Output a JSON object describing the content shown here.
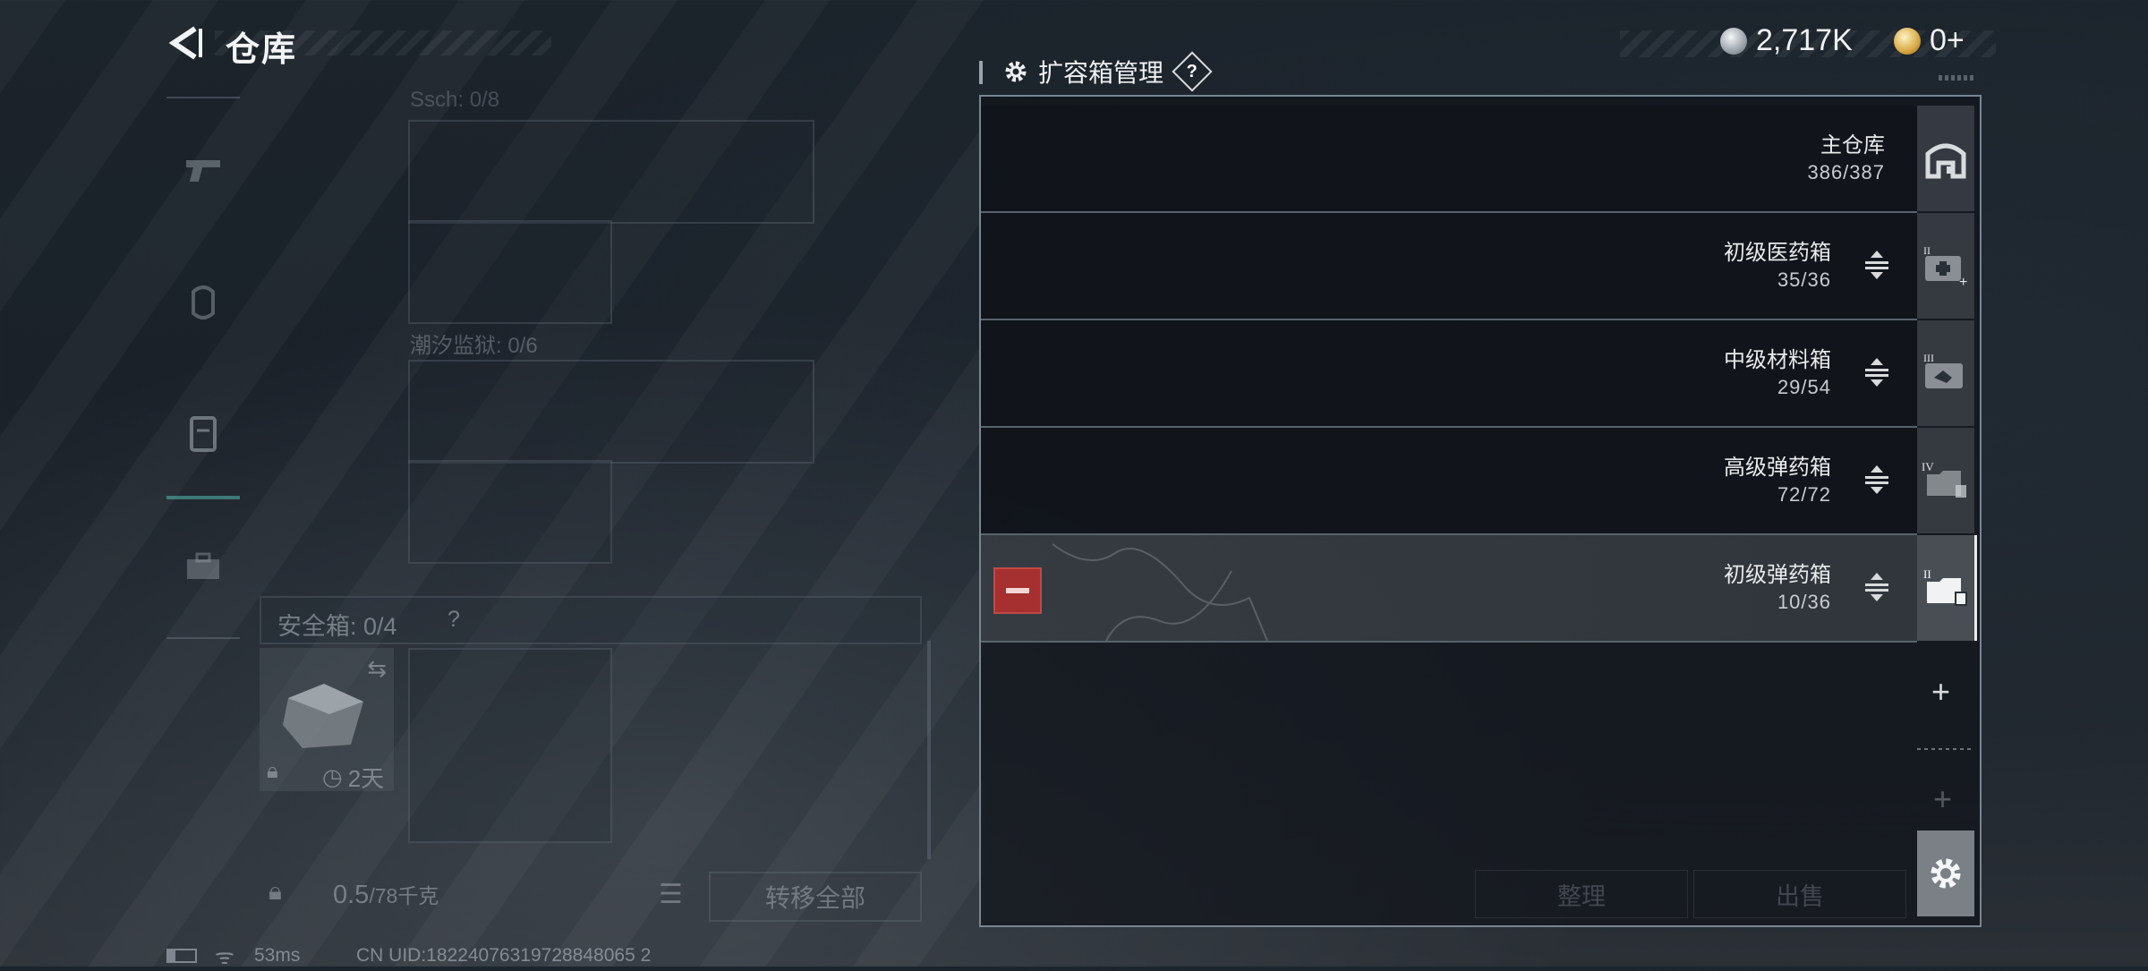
{
  "header": {
    "title": "仓库",
    "currency": [
      {
        "icon": "silver-coin-icon",
        "value": "2,717K"
      },
      {
        "icon": "gold-coin-icon",
        "value": "0+"
      }
    ]
  },
  "inventory": {
    "section_top_label": "Ssch: 0/8",
    "section_label": "潮汐监狱: 0/6",
    "safe_box": {
      "label": "安全箱: 0/4",
      "help": "?",
      "timer": "2天"
    },
    "weight": {
      "value": "0.5",
      "max": "/78千克"
    },
    "transfer_all_label": "转移全部"
  },
  "expansion_panel": {
    "title": "扩容箱管理",
    "help": "?",
    "rows": [
      {
        "name": "主仓库",
        "count": "386/387",
        "icon": "warehouse-icon"
      },
      {
        "name": "初级医药箱",
        "count": "35/36",
        "icon": "medical-case-icon",
        "tier": "II"
      },
      {
        "name": "中级材料箱",
        "count": "29/54",
        "icon": "material-case-icon",
        "tier": "III"
      },
      {
        "name": "高级弹药箱",
        "count": "72/72",
        "icon": "ammo-case-icon",
        "tier": "IV"
      },
      {
        "name": "初级弹药箱",
        "count": "10/36",
        "icon": "ammo-case-icon",
        "tier": "II"
      }
    ],
    "add_slot": "+",
    "sort_label": "整理",
    "sell_label": "出售"
  },
  "status_bar": {
    "ping": "53ms",
    "uid": "CN UID:18224076319728848065 2"
  }
}
